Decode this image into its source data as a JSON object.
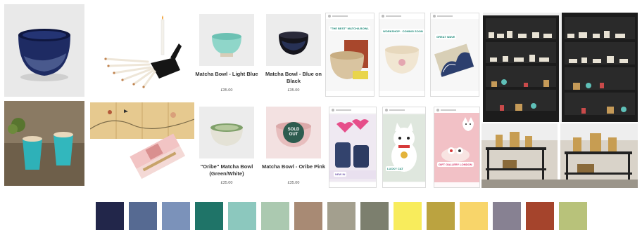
{
  "products": [
    {
      "name": "Matcha Bowl - Light Blue",
      "price": "£35.00"
    },
    {
      "name": "Matcha Bowl - Blue on Black",
      "price": "£35.00"
    },
    {
      "name": "\"Oribe\" Matcha Bowl (Green/White)",
      "price": "£35.00"
    },
    {
      "name": "Matcha Bowl - Oribe Pink",
      "price": "£35.00"
    }
  ],
  "sold_out_badge": "SOLD OUT",
  "stories": [
    {
      "sticker": "\"THE BEST\" MATCHA BOWL"
    },
    {
      "sticker": "WORKSHOP · COMING SOON"
    },
    {
      "sticker": "GREAT WAVE"
    },
    {
      "sticker": "NEW IN"
    },
    {
      "sticker": "LUCKY CAT"
    },
    {
      "sticker": "GIFT GALLERY LONDON"
    }
  ],
  "palette": [
    "#22264a",
    "#566a92",
    "#7b92ba",
    "#1f7468",
    "#8cc8be",
    "#abc9b0",
    "#a88a74",
    "#a39f8e",
    "#7c7f6e",
    "#f8ec5c",
    "#bba340",
    "#f8d56a",
    "#878192",
    "#a5442c",
    "#b8c27a"
  ]
}
